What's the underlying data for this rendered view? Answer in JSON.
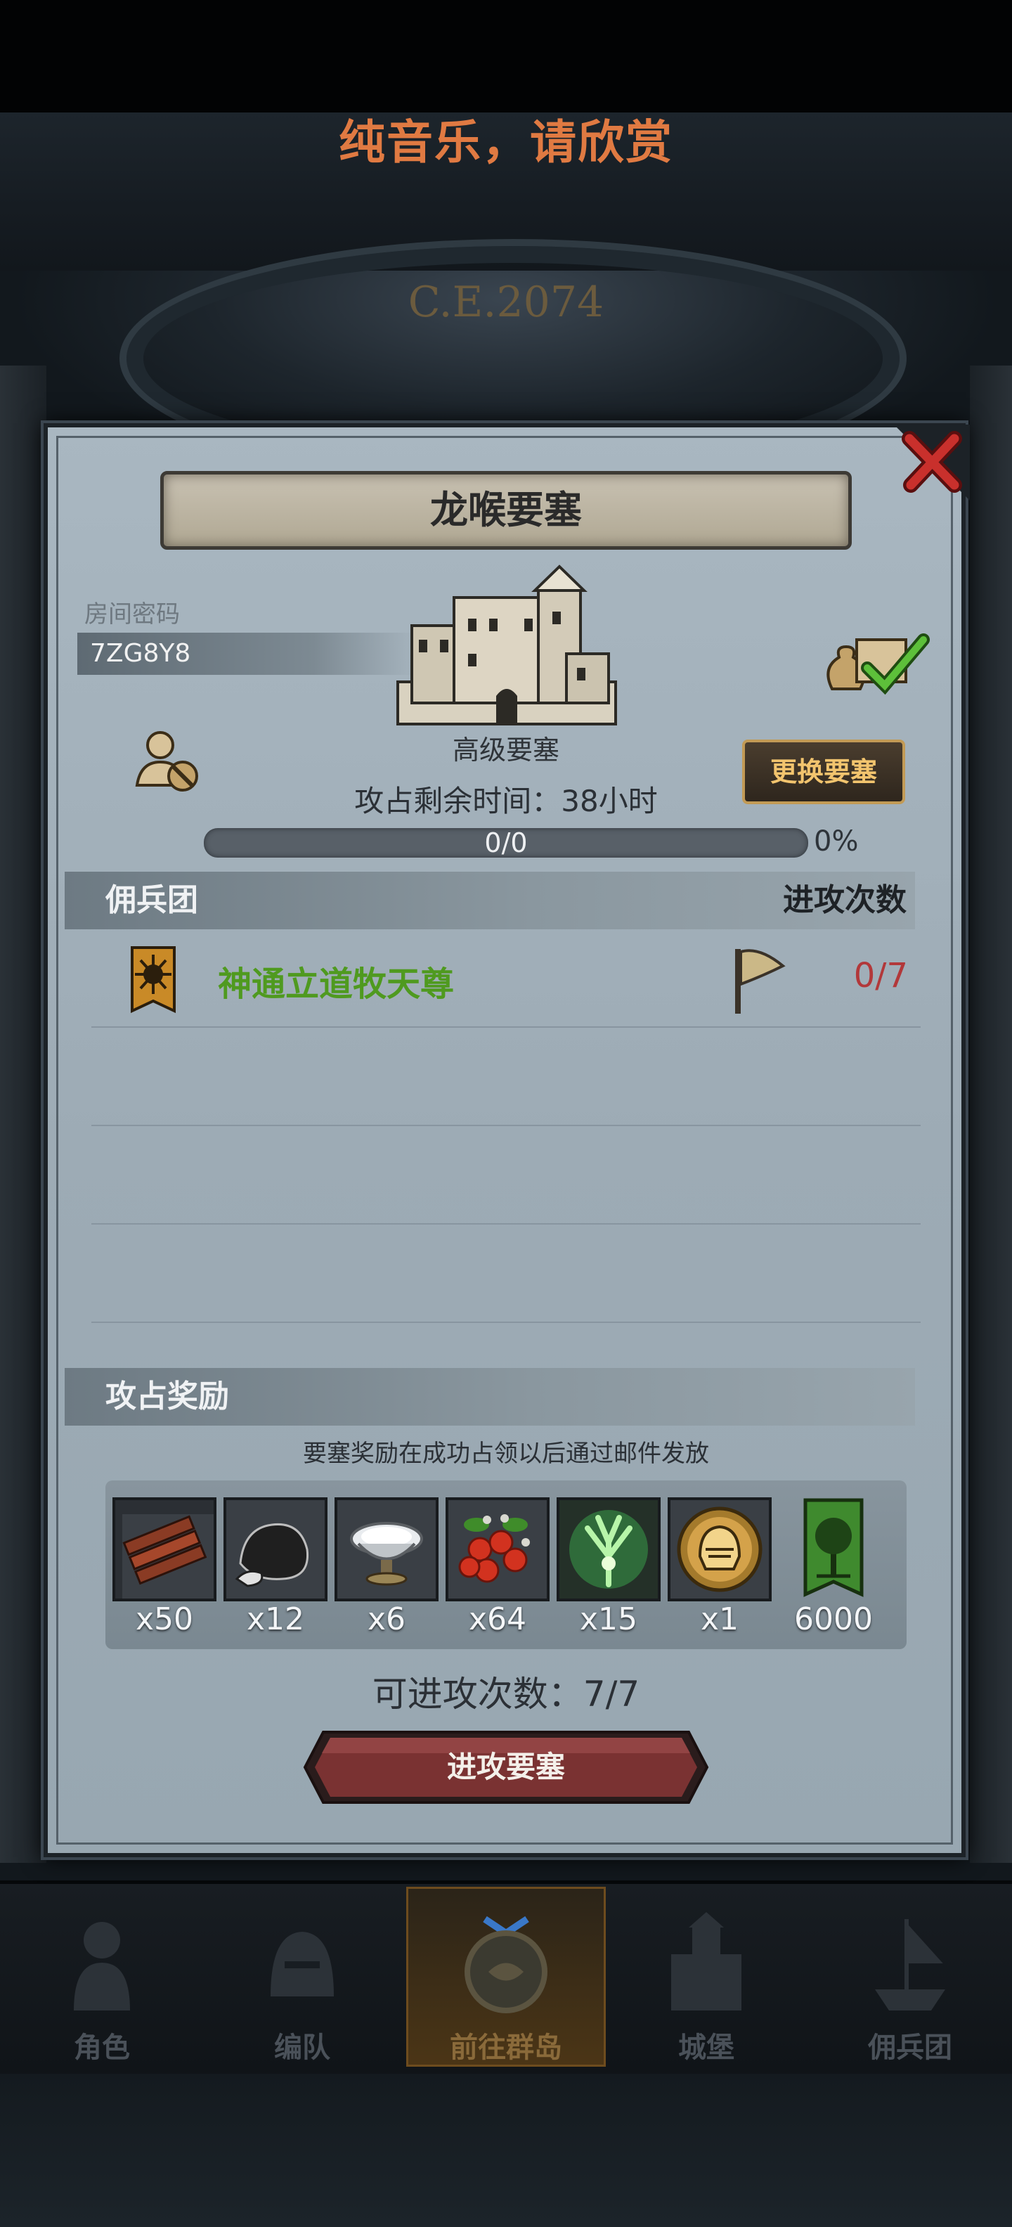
{
  "banner": {
    "text": "纯音乐，请欣赏"
  },
  "background": {
    "era_label": "C.E.2074"
  },
  "dialog": {
    "title": "龙喉要塞",
    "room_label": "房间密码",
    "room_code": "7ZG8Y8",
    "castle_type": "高级要塞",
    "change_button": "更换要塞",
    "time_remaining": "攻占剩余时间：38小时",
    "progress": {
      "current": "0/0",
      "percent_text": "0%",
      "fraction": 0
    },
    "mercenary_header": "佣兵团",
    "attack_count_header": "进攻次数",
    "guilds": [
      {
        "name": "神通立道牧天尊",
        "attacks": "0/7"
      }
    ],
    "reward_header": "攻占奖励",
    "reward_note": "要塞奖励在成功占领以后通过邮件发放",
    "rewards": [
      {
        "icon": "wood-planks-icon",
        "qty": "x50"
      },
      {
        "icon": "ore-rock-icon",
        "qty": "x12"
      },
      {
        "icon": "silver-bowl-icon",
        "qty": "x6"
      },
      {
        "icon": "red-berries-icon",
        "qty": "x64"
      },
      {
        "icon": "green-tree-spirit-icon",
        "qty": "x15"
      },
      {
        "icon": "golden-helmet-medal-icon",
        "qty": "x1"
      },
      {
        "icon": "green-tree-banner-icon",
        "qty": "6000"
      }
    ],
    "remaining_attacks": "可进攻次数：7/7",
    "attack_button": "进攻要塞"
  },
  "nav": [
    {
      "label": "角色",
      "icon": "knight-icon"
    },
    {
      "label": "编队",
      "icon": "helmet-icon"
    },
    {
      "label": "前往群岛",
      "icon": "island-compass-icon"
    },
    {
      "label": "城堡",
      "icon": "castle-icon"
    },
    {
      "label": "佣兵团",
      "icon": "ship-icon"
    }
  ],
  "colors": {
    "banner_text": "#e07a42",
    "guild_name": "#4f9a1f",
    "guild_attacks": "#b2383a",
    "change_button_text": "#f2c46e",
    "attack_button": "#7a3232"
  }
}
